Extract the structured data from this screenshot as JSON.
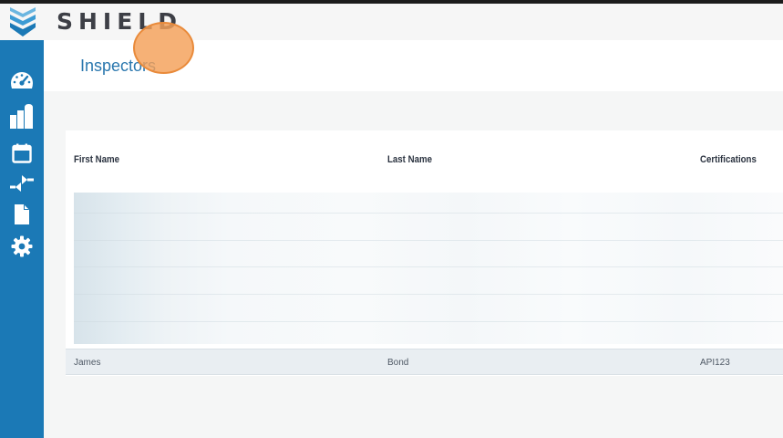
{
  "app": {
    "brand": "SHIELD",
    "colors": {
      "brand_blue": "#1b79b6",
      "title_blue": "#2a77ae",
      "logo_text": "#3d3f46",
      "cursor_marker": "#f4a058"
    }
  },
  "sidebar": {
    "items": [
      {
        "icon": "dashboard-gauge-icon"
      },
      {
        "icon": "facilities-buildings-icon"
      },
      {
        "icon": "calendar-icon"
      },
      {
        "icon": "transfer-arrows-icon"
      },
      {
        "icon": "document-icon"
      },
      {
        "icon": "gear-icon"
      }
    ]
  },
  "page": {
    "title": "Inspectors"
  },
  "table": {
    "columns": [
      "First Name",
      "Last Name",
      "Certifications"
    ],
    "rows": [
      {
        "first_name": "James",
        "last_name": "Bond",
        "certifications": "API123"
      }
    ]
  }
}
